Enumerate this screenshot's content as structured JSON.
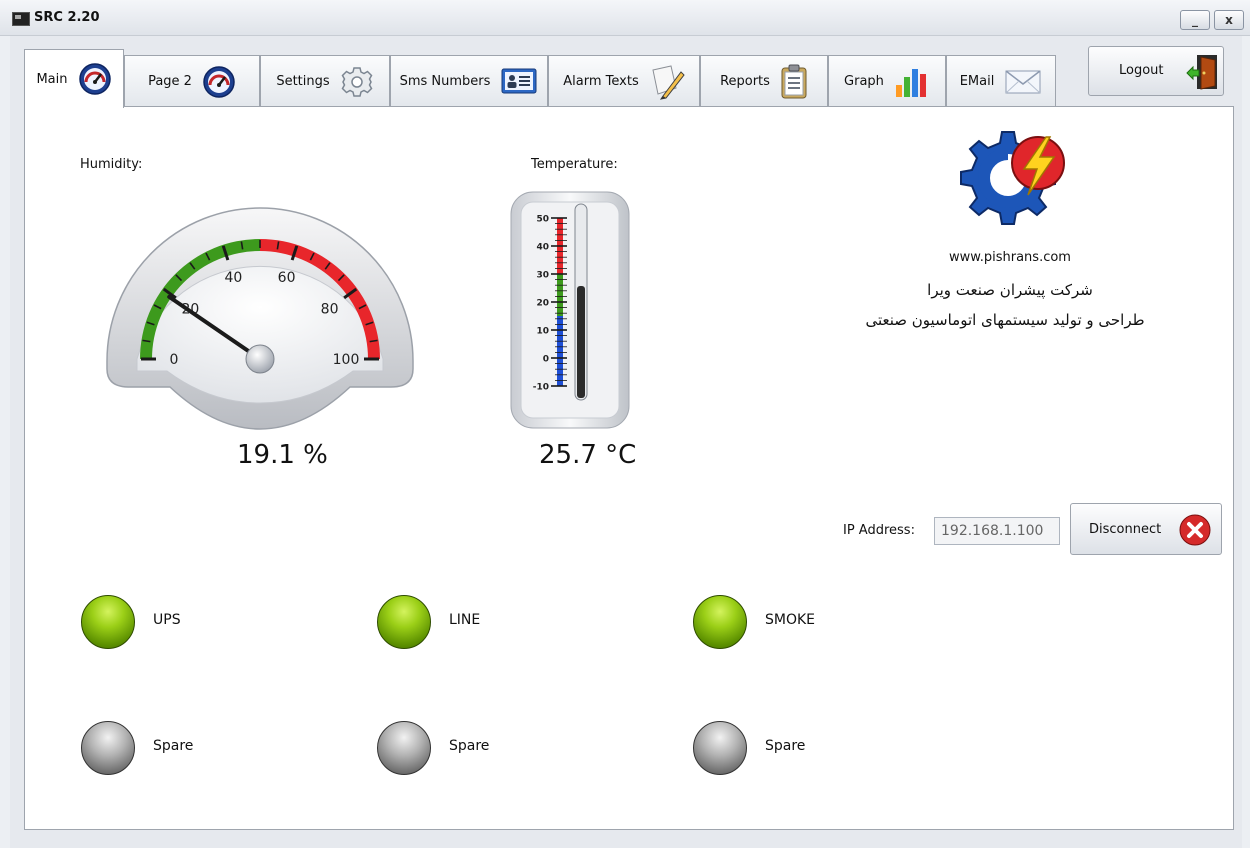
{
  "window": {
    "title": "SRC 2.20",
    "minimize_label": "_",
    "close_label": "x"
  },
  "tabs": [
    {
      "label": "Main",
      "icon": "speedometer-icon"
    },
    {
      "label": "Page 2",
      "icon": "speedometer-icon"
    },
    {
      "label": "Settings",
      "icon": "gear-icon"
    },
    {
      "label": "Sms Numbers",
      "icon": "contact-card-icon"
    },
    {
      "label": "Alarm Texts",
      "icon": "edit-document-icon"
    },
    {
      "label": "Reports",
      "icon": "clipboard-icon"
    },
    {
      "label": "Graph",
      "icon": "bar-chart-icon"
    },
    {
      "label": "EMail",
      "icon": "envelope-icon"
    }
  ],
  "active_tab": "Main",
  "logout": {
    "label": "Logout",
    "icon": "exit-door-icon"
  },
  "humidity": {
    "label": "Humidity:",
    "value": 19.1,
    "display": "19.1 %",
    "scale_min": 0,
    "scale_max": 100,
    "tick_labels": [
      "0",
      "20",
      "40",
      "60",
      "80",
      "100"
    ],
    "green_zone": [
      0,
      50
    ],
    "red_zone": [
      50,
      100
    ]
  },
  "temperature": {
    "label": "Temperature:",
    "value": 25.7,
    "display": "25.7 °C",
    "scale_min": -10,
    "scale_max": 50,
    "tick_labels": [
      "50",
      "40",
      "30",
      "20",
      "10",
      "0",
      "-10"
    ],
    "blue_zone": [
      -10,
      15
    ],
    "green_zone": [
      15,
      30
    ],
    "red_zone": [
      30,
      50
    ]
  },
  "company": {
    "website": "www.pishrans.com",
    "name_fa": "شرکت پیشران صنعت ویرا",
    "tagline_fa": "طراحی و تولید سیستمهای اتوماسیون صنعتی"
  },
  "connection": {
    "ip_label": "IP Address:",
    "ip_value": "192.168.1.100",
    "disconnect_label": "Disconnect"
  },
  "indicators": [
    {
      "label": "UPS",
      "state": "on"
    },
    {
      "label": "LINE",
      "state": "on"
    },
    {
      "label": "SMOKE",
      "state": "on"
    },
    {
      "label": "Spare",
      "state": "off"
    },
    {
      "label": "Spare",
      "state": "off"
    },
    {
      "label": "Spare",
      "state": "off"
    }
  ],
  "colors": {
    "gauge_green": "#3d9a1d",
    "gauge_red": "#e8262b",
    "thermo_blue": "#1e4fd6",
    "led_on": "#8fc515",
    "led_off": "#8a8a8a",
    "disconnect_red": "#d52a2a"
  }
}
